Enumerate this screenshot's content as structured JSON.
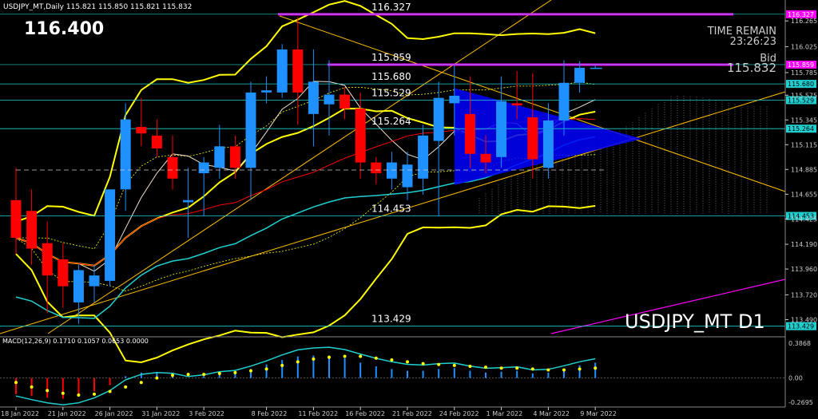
{
  "header": {
    "symbol_line": "USDJPY_MT,Daily  115.821 115.850 115.821 115.832",
    "big_price": "116.400"
  },
  "timer": {
    "label": "TIME REMAIN",
    "value": "23:26:23"
  },
  "bid": {
    "label": "Bid",
    "value": "115.832"
  },
  "watermark": "USDJPY_MT D1",
  "levels": [
    {
      "price": 116.327,
      "label": "116.327",
      "tag": "116.327",
      "kind": "magenta"
    },
    {
      "price": 115.859,
      "label": "115.859",
      "tag": "115.859",
      "kind": "magenta"
    },
    {
      "price": 115.68,
      "label": "115.680",
      "tag": "115.680",
      "kind": "cyan"
    },
    {
      "price": 115.529,
      "label": "115.529",
      "tag": "115.529",
      "kind": "cyan"
    },
    {
      "price": 115.264,
      "label": "115.264",
      "tag": "115.264",
      "kind": "cyan"
    },
    {
      "price": 114.453,
      "label": "114.453",
      "tag": "114.453",
      "kind": "cyan"
    },
    {
      "price": 113.429,
      "label": "113.429",
      "tag": "113.429",
      "kind": "cyan"
    }
  ],
  "price_axis": [
    "116.265",
    "116.025",
    "115.785",
    "115.575",
    "115.345",
    "115.115",
    "114.885",
    "114.655",
    "114.425",
    "114.190",
    "113.960",
    "113.720",
    "113.490"
  ],
  "price_axis_values": [
    116.265,
    116.025,
    115.785,
    115.575,
    115.345,
    115.115,
    114.885,
    114.655,
    114.425,
    114.19,
    113.96,
    113.72,
    113.49
  ],
  "date_axis": [
    "18 Jan 2022",
    "21 Jan 2022",
    "26 Jan 2022",
    "31 Jan 2022",
    "3 Feb 2022",
    "8 Feb 2022",
    "11 Feb 2022",
    "16 Feb 2022",
    "21 Feb 2022",
    "24 Feb 2022",
    "1 Mar 2022",
    "4 Mar 2022",
    "9 Mar 2022"
  ],
  "date_axis_bars": [
    0,
    3,
    6,
    9,
    12,
    16,
    19,
    22,
    25,
    28,
    31,
    34,
    37
  ],
  "macd": {
    "label": "MACD(12,26,9) 0.1710 0.1057 0.0653 0.0000",
    "axis": [
      "0.3868",
      "0.00",
      "-0.2695"
    ],
    "axis_values": [
      0.3868,
      0,
      -0.2695
    ]
  },
  "colors": {
    "bull": "#1e90ff",
    "bear": "#ff0000",
    "yellow": "#ffff00",
    "cyan": "#20d0d0",
    "magenta": "#ff00ff",
    "orange": "#ffbf00",
    "triangle": "#0000ff"
  },
  "chart_data": {
    "type": "candlestick",
    "dates": [
      "18 Jan 2022",
      "19 Jan",
      "20 Jan",
      "21 Jan 2022",
      "24 Jan",
      "25 Jan",
      "26 Jan 2022",
      "27 Jan",
      "28 Jan",
      "31 Jan 2022",
      "1 Feb",
      "2 Feb",
      "3 Feb 2022",
      "4 Feb",
      "7 Feb",
      "8 Feb 2022",
      "9 Feb",
      "10 Feb",
      "11 Feb 2022",
      "14 Feb",
      "15 Feb",
      "16 Feb 2022",
      "17 Feb",
      "18 Feb",
      "21 Feb 2022",
      "22 Feb",
      "23 Feb",
      "24 Feb 2022",
      "25 Feb",
      "28 Feb",
      "1 Mar 2022",
      "2 Mar",
      "3 Mar",
      "4 Mar 2022",
      "7 Mar",
      "8 Mar",
      "9 Mar 2022",
      "10 Mar"
    ],
    "ohlc": [
      [
        114.6,
        114.9,
        114.1,
        114.25
      ],
      [
        114.5,
        114.7,
        114.0,
        114.15
      ],
      [
        114.2,
        114.4,
        113.55,
        113.9
      ],
      [
        114.05,
        114.2,
        113.6,
        113.8
      ],
      [
        113.65,
        114.0,
        113.45,
        113.95
      ],
      [
        113.8,
        114.0,
        113.65,
        113.9
      ],
      [
        113.85,
        114.7,
        113.8,
        114.7
      ],
      [
        114.7,
        115.5,
        114.5,
        115.35
      ],
      [
        115.28,
        115.55,
        115.1,
        115.22
      ],
      [
        115.2,
        115.35,
        115.0,
        115.08
      ],
      [
        115.0,
        115.2,
        114.7,
        114.8
      ],
      [
        114.58,
        114.9,
        114.25,
        114.6
      ],
      [
        114.85,
        115.0,
        114.45,
        114.95
      ],
      [
        114.9,
        115.3,
        114.8,
        115.1
      ],
      [
        115.1,
        115.2,
        114.8,
        114.9
      ],
      [
        114.9,
        115.7,
        114.6,
        115.6
      ],
      [
        115.6,
        115.75,
        115.5,
        115.62
      ],
      [
        115.6,
        116.05,
        115.55,
        116.0
      ],
      [
        116.0,
        116.3,
        115.3,
        115.6
      ],
      [
        115.4,
        116.0,
        115.1,
        115.7
      ],
      [
        115.49,
        115.9,
        115.2,
        115.58
      ],
      [
        115.58,
        115.65,
        115.35,
        115.45
      ],
      [
        115.45,
        115.6,
        114.8,
        114.95
      ],
      [
        114.95,
        115.0,
        114.75,
        114.85
      ],
      [
        114.8,
        115.05,
        114.7,
        114.95
      ],
      [
        114.72,
        115.05,
        114.6,
        114.93
      ],
      [
        114.8,
        115.3,
        114.65,
        115.2
      ],
      [
        115.15,
        115.7,
        114.45,
        115.55
      ],
      [
        115.5,
        115.85,
        115.2,
        115.57
      ],
      [
        115.4,
        115.75,
        114.9,
        115.03
      ],
      [
        115.03,
        115.2,
        114.85,
        114.95
      ],
      [
        115.0,
        115.75,
        114.9,
        115.52
      ],
      [
        115.5,
        115.8,
        115.35,
        115.48
      ],
      [
        115.37,
        115.78,
        114.8,
        114.98
      ],
      [
        114.9,
        115.5,
        114.8,
        115.34
      ],
      [
        115.34,
        115.9,
        115.2,
        115.69
      ],
      [
        115.69,
        115.89,
        115.6,
        115.83
      ],
      [
        115.83,
        115.85,
        115.82,
        115.83
      ]
    ],
    "macd_hist": [
      -0.18,
      -0.2,
      -0.22,
      -0.23,
      -0.2,
      -0.15,
      -0.08,
      0.02,
      0.06,
      0.06,
      0.04,
      0.0,
      0.02,
      0.05,
      0.06,
      0.1,
      0.15,
      0.2,
      0.24,
      0.25,
      0.25,
      0.22,
      0.17,
      0.13,
      0.1,
      0.08,
      0.08,
      0.1,
      0.11,
      0.08,
      0.06,
      0.07,
      0.08,
      0.05,
      0.06,
      0.1,
      0.14,
      0.17
    ],
    "macd_signal": [
      -0.05,
      -0.1,
      -0.14,
      -0.17,
      -0.19,
      -0.18,
      -0.15,
      -0.1,
      -0.05,
      0.0,
      0.03,
      0.04,
      0.04,
      0.05,
      0.06,
      0.08,
      0.1,
      0.14,
      0.18,
      0.21,
      0.23,
      0.24,
      0.24,
      0.22,
      0.2,
      0.18,
      0.16,
      0.15,
      0.14,
      0.13,
      0.12,
      0.11,
      0.11,
      0.1,
      0.09,
      0.09,
      0.1,
      0.11
    ],
    "ylim": [
      113.36,
      116.4
    ],
    "macd_ylim": [
      -0.2695,
      0.3868
    ]
  }
}
